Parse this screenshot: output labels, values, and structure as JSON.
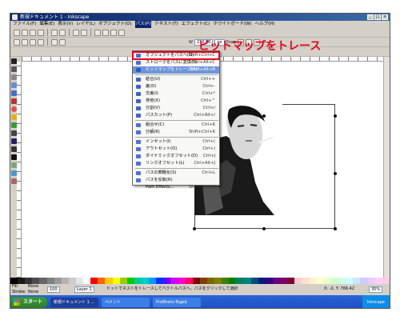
{
  "window": {
    "title": "新規ドキュメント 1 - Inkscape"
  },
  "menubar": [
    "ファイル(F)",
    "編集(E)",
    "表示(V)",
    "レイヤ(L)",
    "オブジェクト(O)",
    "パス(P)",
    "テキスト(T)",
    "エフェクト(C)",
    "ホワイトボード(W)",
    "ヘルプ(H)"
  ],
  "active_menu_index": 5,
  "toolbar": {
    "width_label": "W",
    "width_value": "210.00",
    "unit": "px",
    "snap_label": "Snap"
  },
  "callout": "ビットマップをトレース",
  "path_menu": [
    {
      "label": "オブジェクトをパスへ(O)",
      "shortcut": "Shift+Ctrl+C",
      "icon_color": "#4a6fd0"
    },
    {
      "label": "ストロークをパスに変換(S)",
      "shortcut": "Ctrl+Alt+C",
      "icon_color": "#4a6fd0"
    },
    {
      "label": "ビットマップをトレース(B)...",
      "shortcut": "Shift+Alt+B",
      "icon_color": "#2e5bbf"
    },
    {
      "label": "結合(U)",
      "shortcut": "Ctrl++",
      "icon_color": "#3f63c5"
    },
    {
      "label": "差(D)",
      "shortcut": "Ctrl+-",
      "icon_color": "#3f63c5"
    },
    {
      "label": "交差(I)",
      "shortcut": "Ctrl+*",
      "icon_color": "#3f63c5"
    },
    {
      "label": "排他(X)",
      "shortcut": "Ctrl+^",
      "icon_color": "#3f63c5"
    },
    {
      "label": "分割(V)",
      "shortcut": "Ctrl+/",
      "icon_color": "#3f63c5"
    },
    {
      "label": "パスカット(P)",
      "shortcut": "Ctrl+Alt+/",
      "icon_color": "#3f63c5"
    },
    {
      "label": "組合せ(C)",
      "shortcut": "Ctrl+K",
      "icon_color": "#5070d8"
    },
    {
      "label": "分解(K)",
      "shortcut": "Shift+Ctrl+K",
      "icon_color": "#5070d8"
    },
    {
      "label": "インセット(I)",
      "shortcut": "Ctrl+(",
      "icon_color": "#5070d8"
    },
    {
      "label": "アウトセット(O)",
      "shortcut": "Ctrl+)",
      "icon_color": "#5070d8"
    },
    {
      "label": "ダイナミックオフセット(D)",
      "shortcut": "Ctrl+J",
      "icon_color": "#5070d8"
    },
    {
      "label": "リンクオフセット(L)",
      "shortcut": "Ctrl+Alt+J",
      "icon_color": "#5070d8"
    },
    {
      "label": "パスの簡略化(S)",
      "shortcut": "Ctrl+L",
      "icon_color": "#5070d8"
    },
    {
      "label": "パスを反転(R)",
      "shortcut": "",
      "icon_color": "#5070d8"
    },
    {
      "label": "Path Effects...",
      "shortcut": "Shift+Ctrl+7",
      "icon_color": ""
    }
  ],
  "highlighted_index": 2,
  "statusbar": {
    "fill_label": "Fill:",
    "fill_value": "None",
    "stroke_label": "Stroke:",
    "stroke_value": "None",
    "opacity": "100",
    "layer": "Layer 1",
    "message": "ドットでネストをトレースしてベクトルパスへ。パスをクリックして選択",
    "coords": "X: -2, Y: 766.42",
    "zoom": "35%"
  },
  "taskbar": {
    "start": "スタート",
    "tasks": [
      "新規ドキュメント 1 ...",
      "ペイント",
      "ProBhoto-Togeb"
    ],
    "tray": "Inkscape"
  },
  "colors": {
    "accent": "#6f95d8",
    "callout": "#e8001c",
    "palette": [
      "#000000",
      "#1a1a1a",
      "#333333",
      "#4d4d4d",
      "#666666",
      "#808080",
      "#999999",
      "#b3b3b3",
      "#cccccc",
      "#e6e6e6",
      "#ffffff",
      "#ff0000",
      "#ff6600",
      "#ffcc00",
      "#ffff00",
      "#99cc00",
      "#00cc00",
      "#00cc99",
      "#00cccc",
      "#0099ff",
      "#0033ff",
      "#6600ff",
      "#cc00ff",
      "#ff00cc",
      "#ff0066",
      "#800000",
      "#804000",
      "#806600",
      "#808000",
      "#408000",
      "#008000",
      "#008060",
      "#008080",
      "#004d80",
      "#001a80",
      "#330080",
      "#660080",
      "#800066",
      "#800033",
      "#ffcccc",
      "#ffe0cc",
      "#fff2cc",
      "#ffffcc",
      "#e6ffcc",
      "#ccffcc",
      "#ccffe6",
      "#ccffff",
      "#cce6ff",
      "#ccccff",
      "#e6ccff",
      "#ffccff",
      "#ffcce6"
    ]
  }
}
